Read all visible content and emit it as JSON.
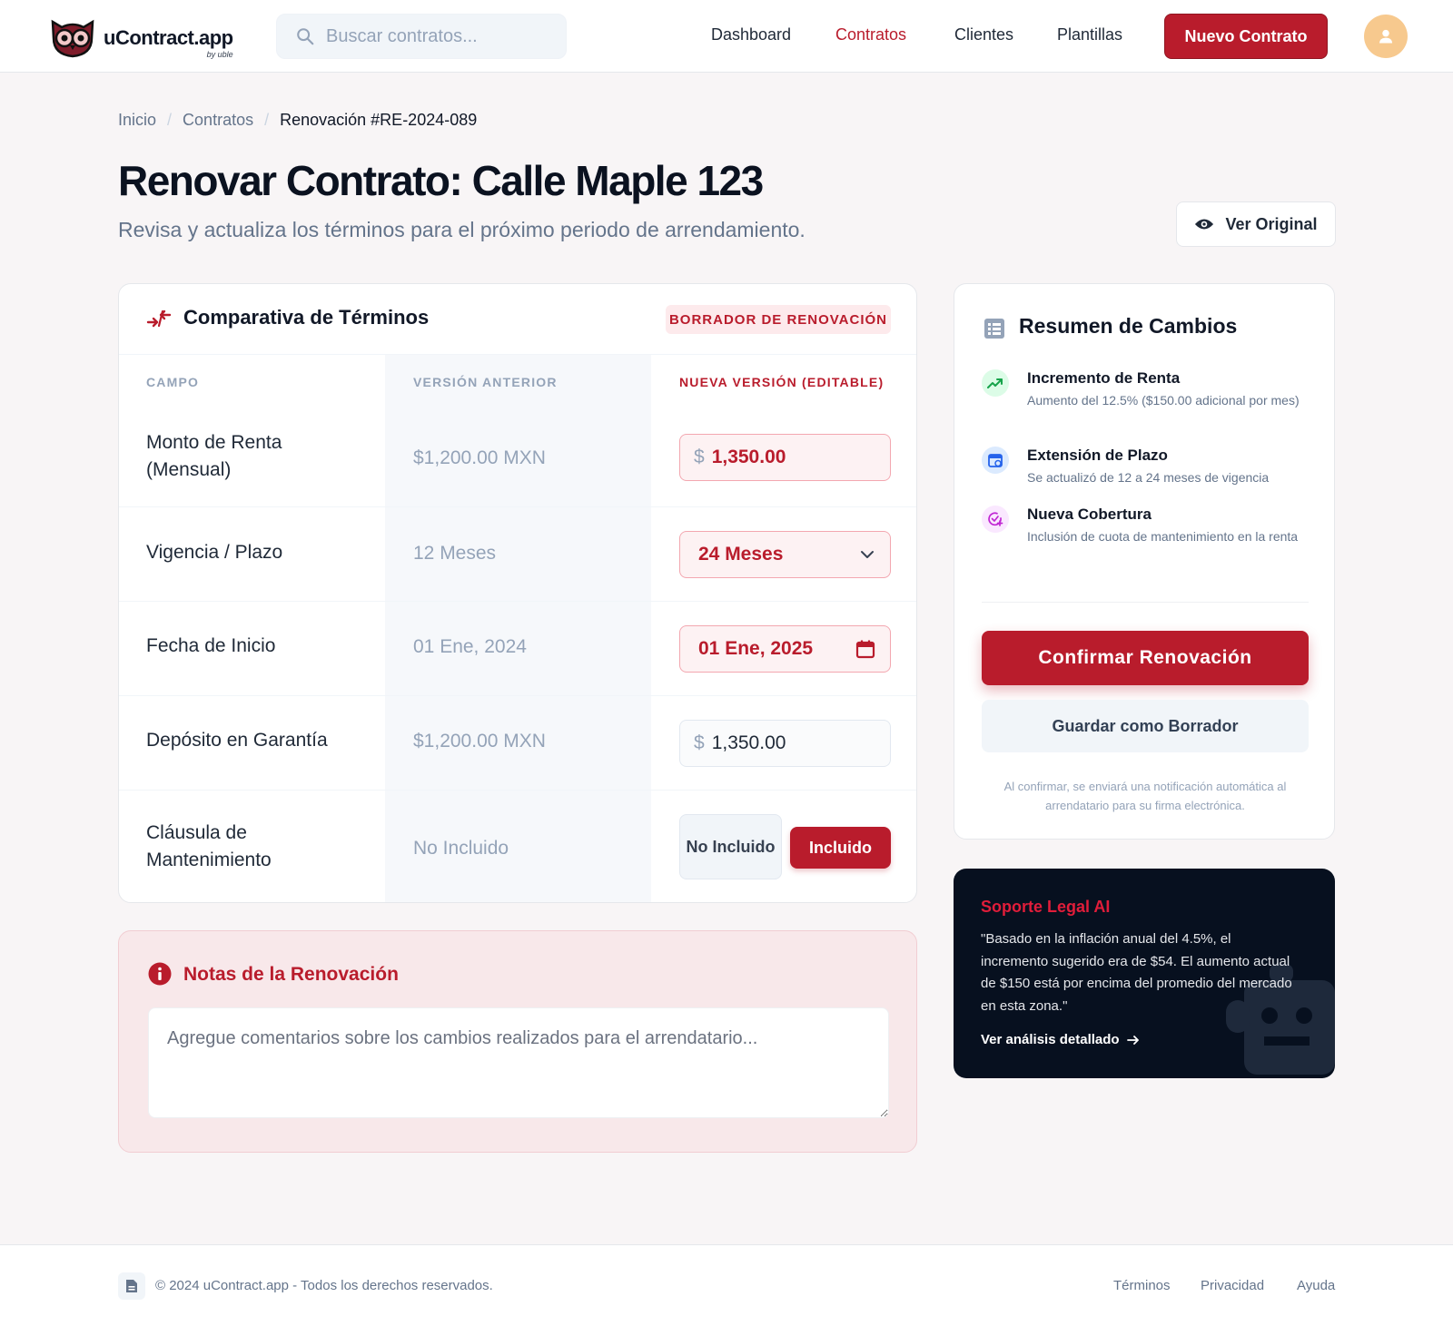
{
  "header": {
    "logo_name": "uContract.app",
    "logo_by": "by uble",
    "search_placeholder": "Buscar contratos...",
    "nav": [
      "Dashboard",
      "Contratos",
      "Clientes",
      "Plantillas"
    ],
    "active_nav": "Contratos",
    "new_button": "Nuevo Contrato"
  },
  "breadcrumb": {
    "home": "Inicio",
    "section": "Contratos",
    "current": "Renovación #RE-2024-089"
  },
  "page": {
    "title": "Renovar Contrato: Calle Maple 123",
    "subtitle": "Revisa y actualiza los términos para el próximo periodo de arrendamiento.",
    "view_original": "Ver Original"
  },
  "compare": {
    "title": "Comparativa de Términos",
    "badge": "BORRADOR DE RENOVACIÓN",
    "columns": {
      "field": "CAMPO",
      "old": "VERSIÓN ANTERIOR",
      "new": "NUEVA VERSIÓN (EDITABLE)"
    },
    "currency_symbol": "$",
    "rows": {
      "rent": {
        "label": "Monto de Renta (Mensual)",
        "old": "$1,200.00 MXN",
        "new": "1,350.00"
      },
      "term": {
        "label": "Vigencia / Plazo",
        "old": "12 Meses",
        "new": "24 Meses"
      },
      "start": {
        "label": "Fecha de Inicio",
        "old": "01 Ene, 2024",
        "new": "01 Ene, 2025"
      },
      "deposit": {
        "label": "Depósito en Garantía",
        "old": "$1,200.00 MXN",
        "new": "1,350.00"
      },
      "maintenance": {
        "label": "Cláusula de Mantenimiento",
        "old": "No Incluido",
        "option_no": "No Incluido",
        "option_yes": "Incluido",
        "selected": "Incluido"
      }
    }
  },
  "notes": {
    "title": "Notas de la Renovación",
    "placeholder": "Agregue comentarios sobre los cambios realizados para el arrendatario..."
  },
  "summary": {
    "title": "Resumen de Cambios",
    "changes": [
      {
        "title": "Incremento de Renta",
        "desc": "Aumento del 12.5% ($150.00 adicional por mes)",
        "icon": "trending-up-icon",
        "color": "#16a34a"
      },
      {
        "title": "Extensión de Plazo",
        "desc": "Se actualizó de 12 a 24 meses de vigencia",
        "icon": "calendar-sync-icon",
        "color": "#2563eb"
      },
      {
        "title": "Nueva Cobertura",
        "desc": "Inclusión de cuota de mantenimiento en la renta",
        "icon": "check-plus-icon",
        "color": "#c026d3"
      }
    ],
    "confirm": "Confirmar Renovación",
    "save_draft": "Guardar como Borrador",
    "note": "Al confirmar, se enviará una notificación automática al arrendatario para su firma electrónica."
  },
  "ai": {
    "title": "Soporte Legal AI",
    "text": "\"Basado en la inflación anual del 4.5%, el incremento sugerido era de $54. El aumento actual de $150 está por encima del promedio del mercado en esta zona.\"",
    "link": "Ver análisis detallado"
  },
  "footer": {
    "copyright": "© 2024 uContract.app - Todos los derechos reservados.",
    "links": [
      "Términos",
      "Privacidad",
      "Ayuda"
    ]
  },
  "colors": {
    "brand": "#b91c2c",
    "dark": "#07101f",
    "muted": "#64748b"
  }
}
